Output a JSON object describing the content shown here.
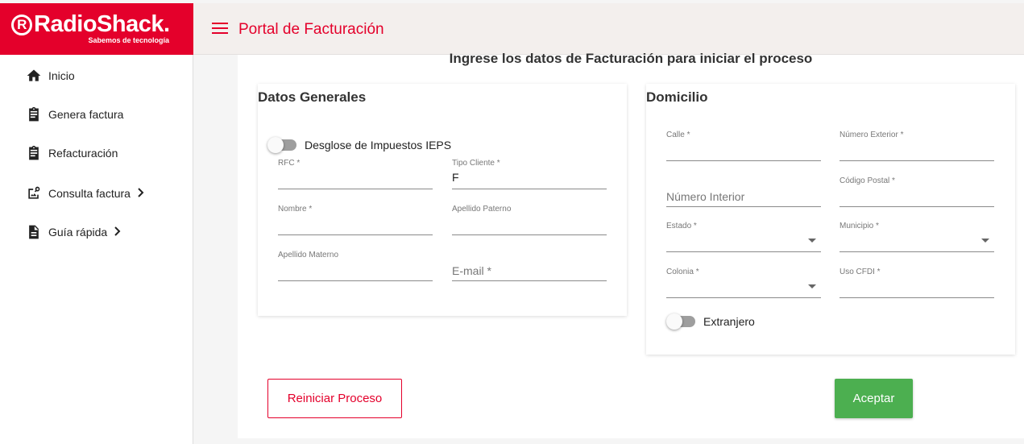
{
  "brand": {
    "logo_text": "RadioShack.",
    "tagline": "Sabemos de tecnología"
  },
  "topbar": {
    "title": "Portal de Facturación"
  },
  "sidebar": {
    "items": [
      {
        "label": "Inicio",
        "icon": "home-icon"
      },
      {
        "label": "Genera factura",
        "icon": "clipboard-icon"
      },
      {
        "label": "Refacturación",
        "icon": "clipboard-icon"
      },
      {
        "label": "Consulta factura",
        "icon": "image-search-icon",
        "chevron": "›"
      },
      {
        "label": "Guía rápida",
        "icon": "document-icon",
        "chevron": "›"
      }
    ]
  },
  "main": {
    "header": "Ingrese los datos de Facturación para iniciar el proceso",
    "datos_generales": {
      "title": "Datos Generales",
      "ieps_toggle": "Desglose de Impuestos IEPS",
      "rfc": {
        "label": "RFC *",
        "value": ""
      },
      "tipo_cliente": {
        "label": "Tipo Cliente *",
        "value": "F"
      },
      "nombre": {
        "label": "Nombre *",
        "value": ""
      },
      "apellido_paterno": {
        "label": "Apellido Paterno",
        "value": ""
      },
      "apellido_materno": {
        "label": "Apellido Materno",
        "value": ""
      },
      "email": {
        "placeholder": "E-mail *"
      }
    },
    "domicilio": {
      "title": "Domicilio",
      "calle": {
        "label": "Calle *",
        "value": ""
      },
      "numero_exterior": {
        "label": "Número Exterior *",
        "value": ""
      },
      "numero_interior": {
        "placeholder": "Número Interior"
      },
      "codigo_postal": {
        "label": "Código Postal *",
        "value": ""
      },
      "estado": {
        "label": "Estado *",
        "value": ""
      },
      "municipio": {
        "label": "Municipio *",
        "value": ""
      },
      "colonia": {
        "label": "Colonia *",
        "value": ""
      },
      "uso_cfdi": {
        "label": "Uso CFDI *",
        "value": ""
      },
      "extranjero_toggle": "Extranjero"
    },
    "buttons": {
      "reset": "Reiniciar Proceso",
      "accept": "Aceptar"
    }
  },
  "colors": {
    "brand_red": "#e4002b",
    "accept_green": "#4caf50"
  }
}
